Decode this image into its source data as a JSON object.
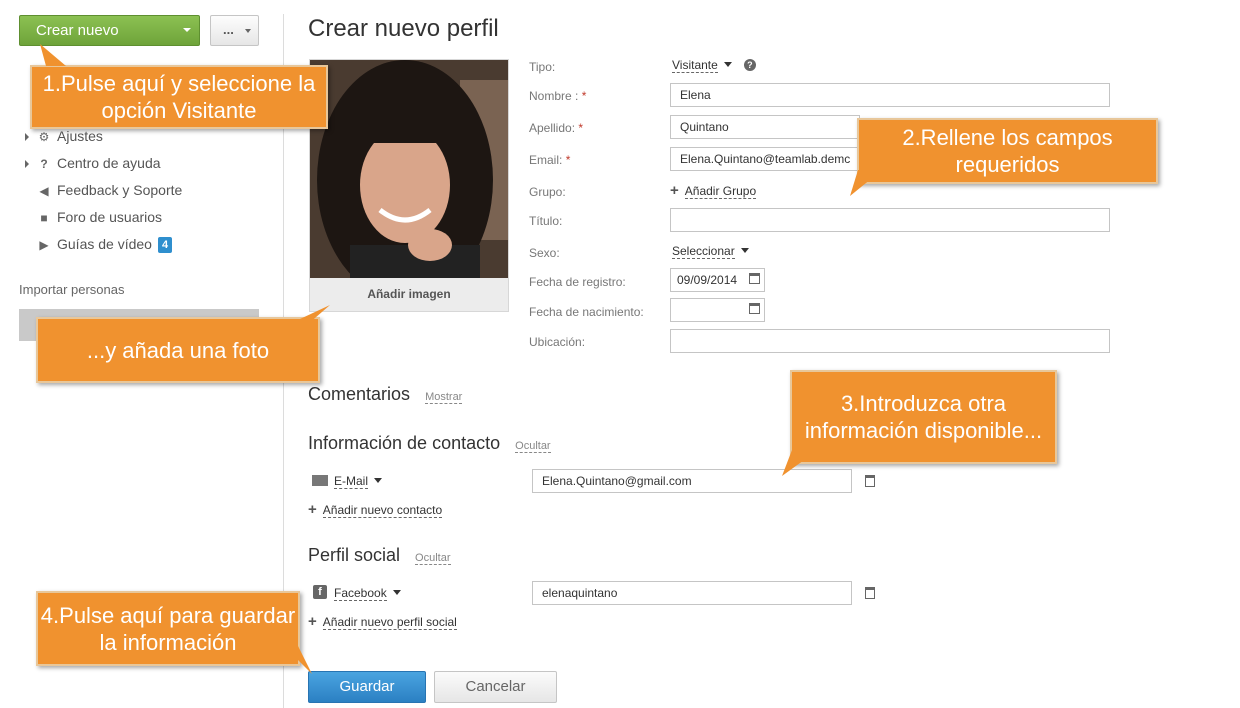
{
  "sidebar": {
    "create_button": "Crear nuevo",
    "more_button": "...",
    "items": [
      {
        "label": "Ajustes",
        "icon": "gear-icon"
      },
      {
        "label": "Centro de ayuda",
        "icon": "question-icon"
      },
      {
        "label": "Feedback y Soporte",
        "icon": "megaphone-icon"
      },
      {
        "label": "Foro de usuarios",
        "icon": "speech-bubble-icon"
      },
      {
        "label": "Guías de vídeo",
        "icon": "play-icon",
        "badge": "4"
      }
    ],
    "import_title": "Importar personas"
  },
  "form": {
    "title": "Crear nuevo perfil",
    "photo_button": "Añadir imagen",
    "tipo": {
      "label": "Tipo:",
      "value": "Visitante"
    },
    "nombre": {
      "label": "Nombre :",
      "required": "*",
      "value": "Elena"
    },
    "apellido": {
      "label": "Apellido:",
      "required": "*",
      "value": "Quintano"
    },
    "email": {
      "label": "Email:",
      "required": "*",
      "value": "Elena.Quintano@teamlab.demc"
    },
    "grupo": {
      "label": "Grupo:",
      "link": "Añadir Grupo"
    },
    "titulo": {
      "label": "Título:",
      "value": ""
    },
    "sexo": {
      "label": "Sexo:",
      "value": "Seleccionar"
    },
    "registro": {
      "label": "Fecha de registro:",
      "value": "09/09/2014"
    },
    "nacimiento": {
      "label": "Fecha de nacimiento:",
      "value": ""
    },
    "ubicacion": {
      "label": "Ubicación:",
      "value": ""
    }
  },
  "comments": {
    "title": "Comentarios",
    "link": "Mostrar"
  },
  "contact": {
    "title": "Información de contacto",
    "link": "Ocultar",
    "type": "E-Mail",
    "value": "Elena.Quintano@gmail.com",
    "add_link": "Añadir nuevo contacto"
  },
  "social": {
    "title": "Perfil social",
    "link": "Ocultar",
    "type": "Facebook",
    "value": "elenaquintano",
    "add_link": "Añadir nuevo perfil social"
  },
  "buttons": {
    "save": "Guardar",
    "cancel": "Cancelar"
  },
  "callouts": {
    "c1": "1.Pulse aquí y seleccione la opción Visitante",
    "c_photo": "...y añada una foto",
    "c2": "2.Rellene los campos requeridos",
    "c3": "3.Introduzca otra información disponible...",
    "c4": "4.Pulse aquí para guardar la información"
  },
  "colors": {
    "callout": "#f0922f",
    "create_green": "#7cb342",
    "save_blue": "#3a92d4"
  }
}
